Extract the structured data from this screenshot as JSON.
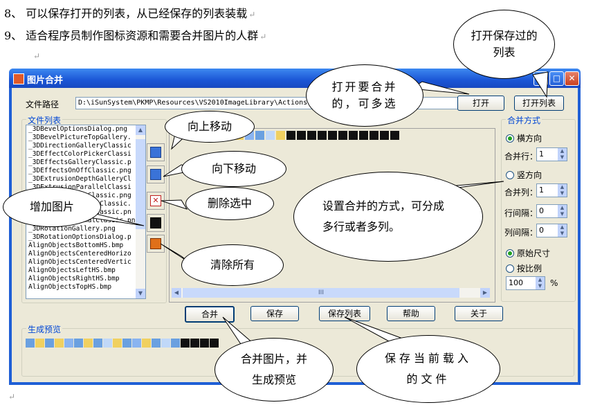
{
  "doc": {
    "line8": "8、 可以保存打开的列表，从已经保存的列表装载",
    "line9": "9、 适合程序员制作图标资源和需要合并图片的人群",
    "para_mark": "↵",
    "bottom_mark": "↵"
  },
  "window": {
    "title": "图片合并",
    "controls": {
      "minimize": "_",
      "maximize": "□",
      "close": "✕"
    }
  },
  "file_path": {
    "label": "文件路径",
    "value": "D:\\iSunSystem\\PKMP\\Resources\\VS2010ImageLibrary\\Actions\\"
  },
  "buttons": {
    "open": "打开",
    "open_list": "打开列表",
    "merge": "合并",
    "save": "保存",
    "save_list": "保存列表",
    "help": "帮助",
    "about": "关于"
  },
  "file_list": {
    "title": "文件列表",
    "items": [
      "_3DBevelOptionsDialog.png",
      "_3DBevelPictureTopGallery.",
      "_3DDirectionGalleryClassic",
      "_3DEffectColorPickerClassi",
      "_3DEffectsGalleryClassic.p",
      "_3DEffectsOnOffClassic.png",
      "_3DExtrusionDepthGalleryCl",
      "_3DExtrusionParallelClassi",
      "_3DLightingFlatClassic.png",
      "_3DLightingGalleryClassic.",
      "_3DLightingHarshClassic.pn",
      "_3DLightingNormalClassic.png",
      "_3DRotationGallery.png",
      "_3DRotationOptionsDialog.p",
      "AlignObjectsBottomHS.bmp",
      "AlignObjectsCenteredHorizo",
      "AlignObjectsCenteredVertic",
      "AlignObjectsLeftHS.bmp",
      "AlignObjectsRightHS.bmp",
      "AlignObjectsTopHS.bmp"
    ]
  },
  "merge_mode": {
    "title": "合并方式",
    "horizontal": "横方向",
    "rows_label": "合并行：",
    "rows_value": "1",
    "vertical": "竖方向",
    "cols_label": "合并列：",
    "cols_value": "1",
    "row_gap_label": "行间隔：",
    "row_gap_value": "0",
    "col_gap_label": "列间隔：",
    "col_gap_value": "0",
    "original_size": "原始尺寸",
    "by_ratio": "按比例",
    "ratio_value": "100",
    "percent": "%"
  },
  "preview": {
    "title": "生成预览",
    "scroll_grip": "III"
  },
  "callouts": {
    "open_saved": "打开保存过的列表",
    "open_merge": "打开要合并的，可多选",
    "move_up": "向上移动",
    "move_down": "向下移动",
    "delete_selected": "删除选中",
    "add_image": "增加图片",
    "clear_all": "清除所有",
    "set_mode": "设置合并的方式，可分成多行或者多列。",
    "merge_preview": "合并图片，并生成预览",
    "save_loaded": "保存当前载入的文件"
  }
}
